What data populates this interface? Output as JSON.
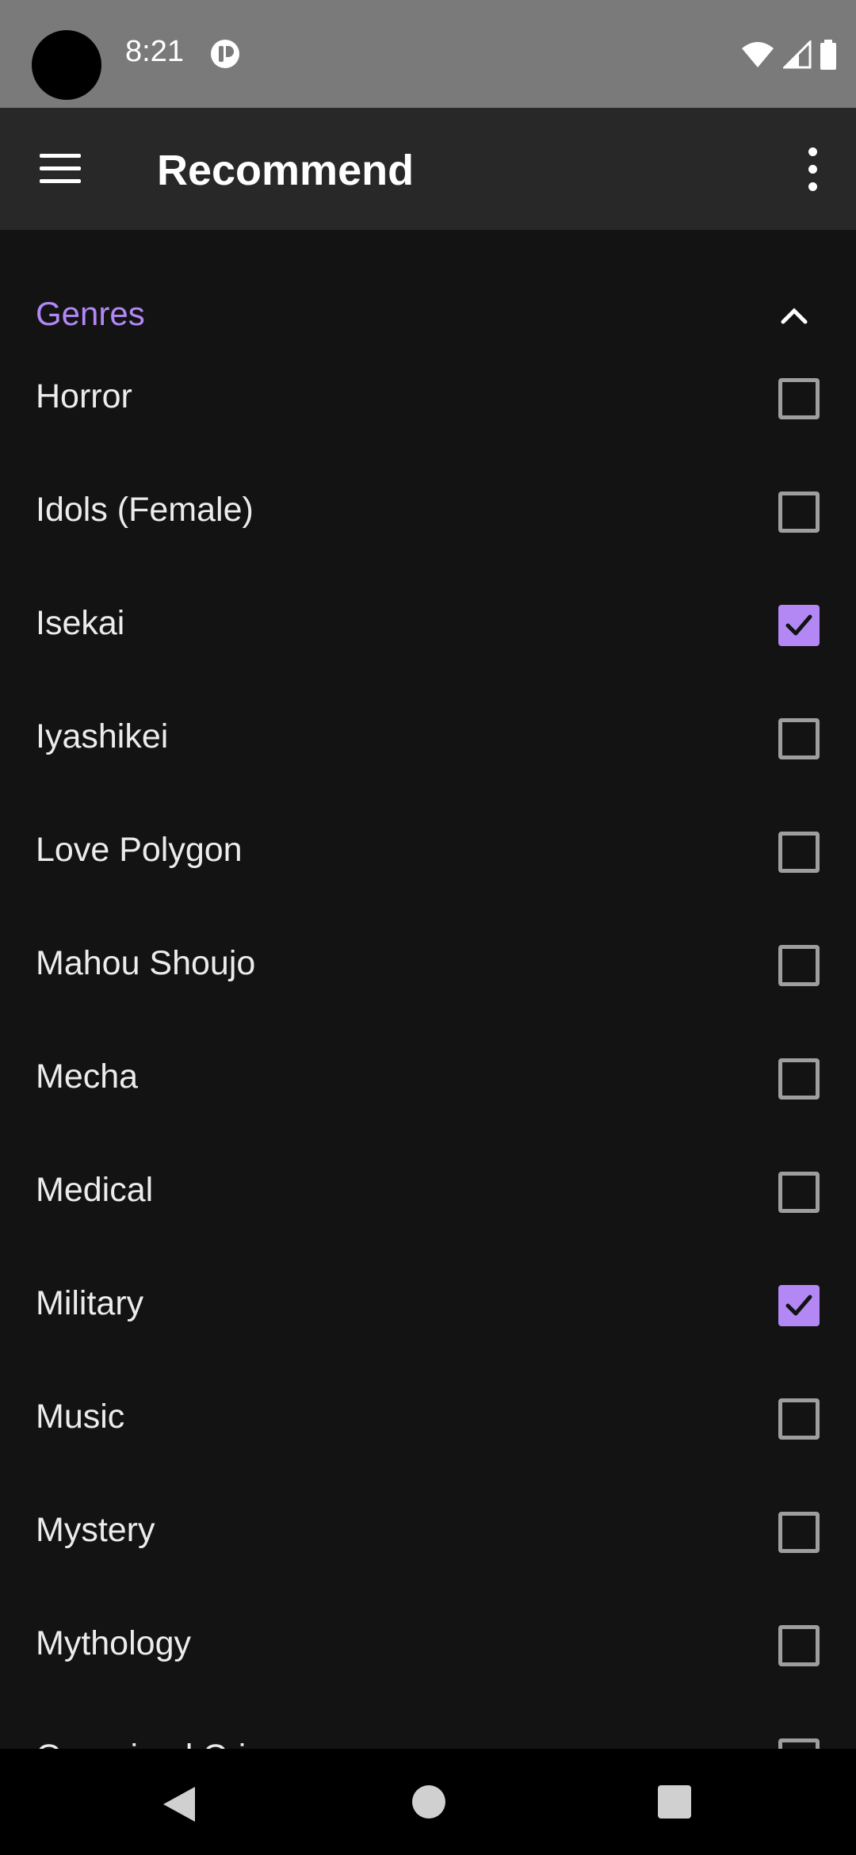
{
  "status_bar": {
    "time": "8:21",
    "icons": [
      "notification-icon",
      "wifi-icon",
      "signal-icon",
      "battery-icon"
    ]
  },
  "app_bar": {
    "title": "Recommend",
    "menu_icon": "hamburger-menu-icon",
    "more_icon": "more-vert-icon"
  },
  "genres": {
    "title": "Genres",
    "expanded": true,
    "accent_color": "#b388f5",
    "items": [
      {
        "label": "Horror",
        "checked": false
      },
      {
        "label": "Idols (Female)",
        "checked": false
      },
      {
        "label": "Isekai",
        "checked": true
      },
      {
        "label": "Iyashikei",
        "checked": false
      },
      {
        "label": "Love Polygon",
        "checked": false
      },
      {
        "label": "Mahou Shoujo",
        "checked": false
      },
      {
        "label": "Mecha",
        "checked": false
      },
      {
        "label": "Medical",
        "checked": false
      },
      {
        "label": "Military",
        "checked": true
      },
      {
        "label": "Music",
        "checked": false
      },
      {
        "label": "Mystery",
        "checked": false
      },
      {
        "label": "Mythology",
        "checked": false
      },
      {
        "label": "Organized Crime",
        "checked": false
      }
    ]
  },
  "nav_bar": {
    "icons": [
      "back-icon",
      "home-icon",
      "recents-icon"
    ]
  }
}
